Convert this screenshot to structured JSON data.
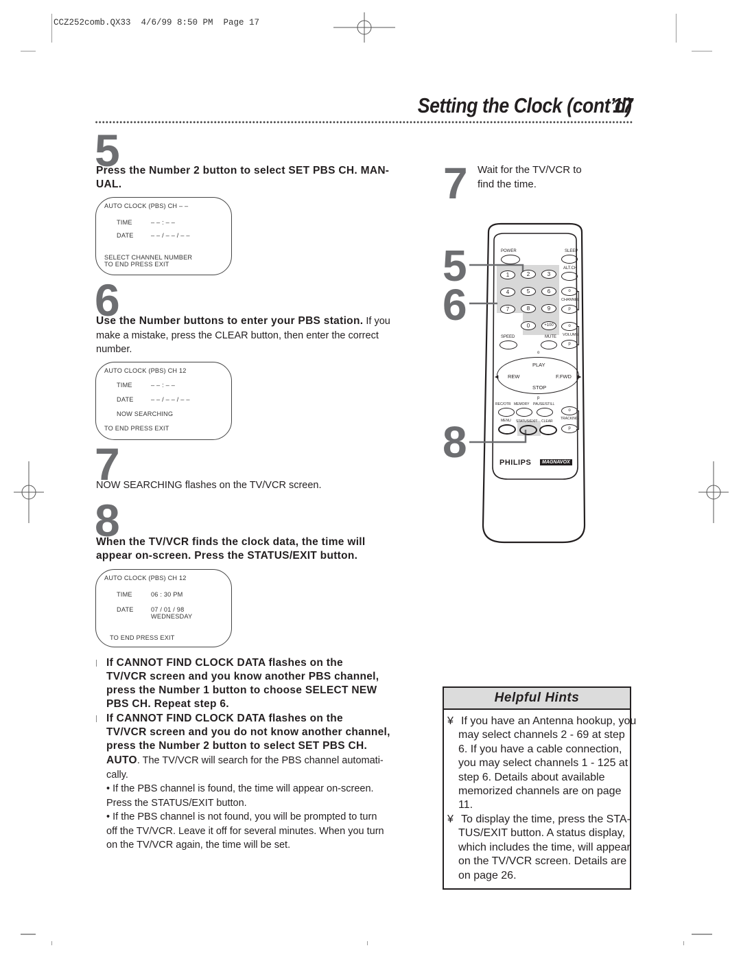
{
  "slug": "CCZ252comb.QX33  4/6/99 8:50 PM  Page 17",
  "header": {
    "title": "Setting the Clock (cont’d)",
    "page_number": "17"
  },
  "steps": {
    "s5": {
      "number": "5",
      "instruction": "Press the Number 2 button to select SET PBS CH. MAN-",
      "instruction2": "UAL.",
      "osd": {
        "line1": "AUTO CLOCK (PBS) CH – –",
        "time_label": "TIME",
        "time_value": "– – : – –",
        "date_label": "DATE",
        "date_value": "– – / – – / – –",
        "footer1": "SELECT CHANNEL NUMBER",
        "footer2": "TO END PRESS EXIT"
      }
    },
    "s6": {
      "number": "6",
      "instruction_bold": "Use the Number buttons to enter your PBS station.",
      "instruction_rest1": " If you",
      "line2": "make a mistake, press the CLEAR button, then enter the correct",
      "line3": "number.",
      "osd": {
        "line1": "AUTO CLOCK (PBS) CH 12",
        "time_label": "TIME",
        "time_value": "– – : – –",
        "date_label": "DATE",
        "date_value": "– – / – – / – –",
        "status": "NOW SEARCHING",
        "footer": "TO END PRESS EXIT"
      }
    },
    "s7": {
      "number": "7",
      "text": "NOW SEARCHING flashes on the TV/VCR screen."
    },
    "s8": {
      "number": "8",
      "instruction1": "When the TV/VCR finds the clock data, the time will",
      "instruction2": "appear on-screen. Press the STATUS/EXIT button.",
      "osd": {
        "line1": "AUTO CLOCK (PBS) CH 12",
        "time_label": "TIME",
        "time_value": "06 : 30 PM",
        "date_label": "DATE",
        "date_value": "07 / 01 / 98",
        "weekday": "WEDNESDAY",
        "footer": "TO END PRESS EXIT"
      }
    }
  },
  "notes": {
    "n1": [
      "If CANNOT FIND CLOCK DATA flashes on the",
      "TV/VCR screen and you know another PBS channel,",
      "press the Number 1 button to choose SELECT NEW",
      "PBS CH. Repeat step 6."
    ],
    "n2": [
      "If CANNOT FIND CLOCK DATA flashes on the",
      "TV/VCR screen and you do not know another channel,",
      "press the Number 2 button to select SET PBS CH."
    ],
    "n2_auto": "AUTO",
    "n2_rest": ". The TV/VCR will search for the PBS channel automati-",
    "n2_cally": "cally.",
    "sub1": [
      "• If the PBS channel is found, the time will appear on-screen.",
      "Press the STATUS/EXIT button."
    ],
    "sub2": [
      "• If the PBS channel is not found, you will be prompted to turn",
      "off the TV/VCR. Leave it off for several minutes. When you turn",
      "on the TV/VCR again, the time will be set."
    ]
  },
  "right": {
    "step7_number": "7",
    "step7_text1": "Wait for the TV/VCR to",
    "step7_text2": "find the time.",
    "callouts": [
      "5",
      "6",
      "8"
    ]
  },
  "remote": {
    "power": "POWER",
    "sleep": "SLEEP",
    "altch": "ALT.CH",
    "digits": [
      "1",
      "2",
      "3",
      "4",
      "5",
      "6",
      "7",
      "8",
      "9",
      "0",
      "+100"
    ],
    "channel": "CHANNEL",
    "volume": "VOLUME",
    "speed": "SPEED",
    "mute": "MUTE",
    "up": "o",
    "down": "p",
    "play": "PLAY",
    "rew": "REW",
    "ffwd": "F.FWD",
    "stop": "STOP",
    "recotr": "REC/OTR",
    "memory": "MEMORY",
    "pause": "PAUSE/STILL",
    "tracking": "TRACKING",
    "menu": "MENU",
    "status_exit": "STATUS/EXIT",
    "clear": "CLEAR",
    "brand1": "PHILIPS",
    "brand2": "MAGNAVOX"
  },
  "hints": {
    "title": "Helpful Hints",
    "bullet": "¥",
    "h1": [
      "If you have an Antenna hookup, you",
      "may select channels 2 - 69 at step",
      "6. If you have a cable connection,",
      "you may select channels 1 - 125 at",
      "step 6. Details about available",
      "memorized channels are on page",
      "11."
    ],
    "h2": [
      "To display the time, press the STA-",
      "TUS/EXIT button. A status display,",
      "which includes the time, will appear",
      "on the TV/VCR screen. Details are",
      "on page 26."
    ]
  }
}
